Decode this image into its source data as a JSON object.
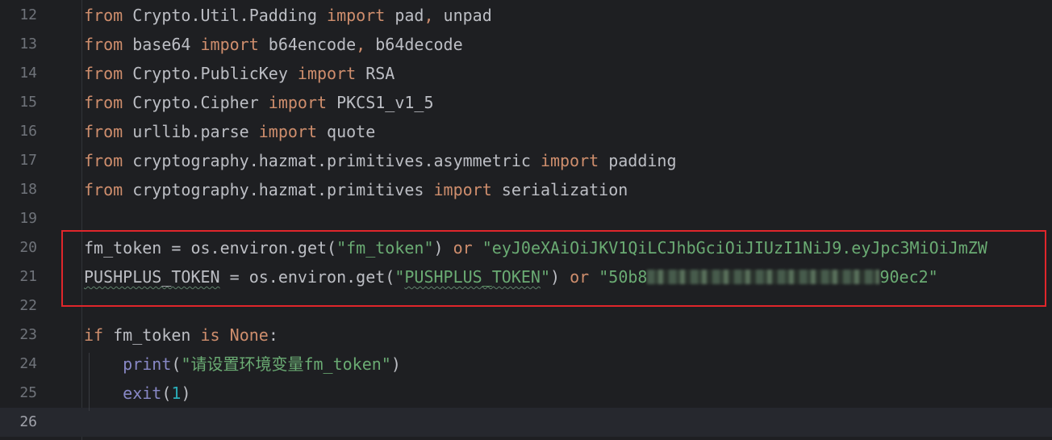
{
  "editor": {
    "colors": {
      "background": "#1e1f22",
      "keyword": "#cf8e6d",
      "string": "#6aab73",
      "number": "#2aacb8",
      "builtin": "#8888c6",
      "text": "#bcbec4",
      "line_number": "#6f737a",
      "highlight_border": "#e0262b"
    },
    "current_line": 26,
    "lines": [
      {
        "n": "12",
        "tokens": [
          [
            "kw",
            "from"
          ],
          [
            "plain",
            " Crypto.Util.Padding "
          ],
          [
            "kw",
            "import"
          ],
          [
            "plain",
            " pad"
          ],
          [
            "kw",
            ","
          ],
          [
            "plain",
            " unpad"
          ]
        ]
      },
      {
        "n": "13",
        "tokens": [
          [
            "kw",
            "from"
          ],
          [
            "plain",
            " base64 "
          ],
          [
            "kw",
            "import"
          ],
          [
            "plain",
            " b64encode"
          ],
          [
            "kw",
            ","
          ],
          [
            "plain",
            " b64decode"
          ]
        ]
      },
      {
        "n": "14",
        "tokens": [
          [
            "kw",
            "from"
          ],
          [
            "plain",
            " Crypto.PublicKey "
          ],
          [
            "kw",
            "import"
          ],
          [
            "plain",
            " RSA"
          ]
        ]
      },
      {
        "n": "15",
        "tokens": [
          [
            "kw",
            "from"
          ],
          [
            "plain",
            " Crypto.Cipher "
          ],
          [
            "kw",
            "import"
          ],
          [
            "plain",
            " PKCS1_v1_5"
          ]
        ]
      },
      {
        "n": "16",
        "tokens": [
          [
            "kw",
            "from"
          ],
          [
            "plain",
            " urllib.parse "
          ],
          [
            "kw",
            "import"
          ],
          [
            "plain",
            " quote"
          ]
        ]
      },
      {
        "n": "17",
        "tokens": [
          [
            "kw",
            "from"
          ],
          [
            "plain",
            " cryptography.hazmat.primitives.asymmetric "
          ],
          [
            "kw",
            "import"
          ],
          [
            "plain",
            " padding"
          ]
        ]
      },
      {
        "n": "18",
        "tokens": [
          [
            "kw",
            "from"
          ],
          [
            "plain",
            " cryptography.hazmat.primitives "
          ],
          [
            "kw",
            "import"
          ],
          [
            "plain",
            " serialization"
          ]
        ]
      },
      {
        "n": "19",
        "tokens": []
      },
      {
        "n": "20",
        "tokens": [
          [
            "plain",
            "fm_token = os.environ.get("
          ],
          [
            "str",
            "\"fm_token\""
          ],
          [
            "plain",
            ") "
          ],
          [
            "kw",
            "or"
          ],
          [
            "plain",
            " "
          ],
          [
            "str",
            "\"eyJ0eXAiOiJKV1QiLCJhbGciOiJIUzI1NiJ9.eyJpc3MiOiJmZW"
          ]
        ]
      },
      {
        "n": "21",
        "tokens": [
          [
            "plainsq",
            "PUSHPLUS_TOKEN"
          ],
          [
            "plain",
            " = os.environ.get("
          ],
          [
            "str",
            "\""
          ],
          [
            "strsq",
            "PUSHPLUS_TOKEN"
          ],
          [
            "str",
            "\""
          ],
          [
            "plain",
            ") "
          ],
          [
            "kw",
            "or"
          ],
          [
            "plain",
            " "
          ],
          [
            "str",
            "\"50b8"
          ],
          [
            "blur",
            ""
          ],
          [
            "str",
            "90ec2\""
          ]
        ]
      },
      {
        "n": "22",
        "tokens": []
      },
      {
        "n": "23",
        "tokens": [
          [
            "kw",
            "if"
          ],
          [
            "plain",
            " fm_token "
          ],
          [
            "kw",
            "is"
          ],
          [
            "plain",
            " "
          ],
          [
            "kw",
            "None"
          ],
          [
            "plain",
            ":"
          ]
        ]
      },
      {
        "n": "24",
        "tokens": [
          [
            "plain",
            "    "
          ],
          [
            "builtin",
            "print"
          ],
          [
            "plain",
            "("
          ],
          [
            "str",
            "\"请设置环境变量fm_token\""
          ],
          [
            "plain",
            ")"
          ]
        ]
      },
      {
        "n": "25",
        "tokens": [
          [
            "plain",
            "    "
          ],
          [
            "builtin",
            "exit"
          ],
          [
            "plain",
            "("
          ],
          [
            "num",
            "1"
          ],
          [
            "plain",
            ")"
          ]
        ]
      },
      {
        "n": "26",
        "tokens": []
      }
    ]
  }
}
